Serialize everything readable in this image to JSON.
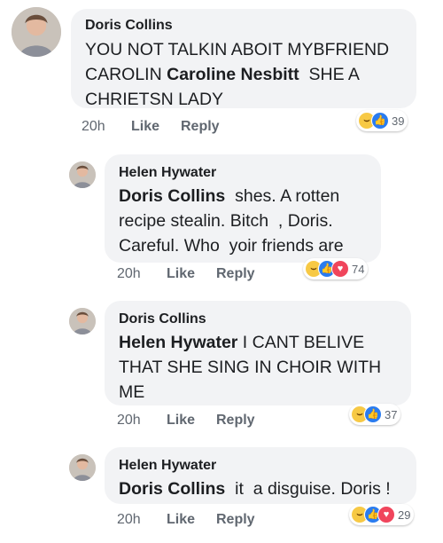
{
  "comments": [
    {
      "author": "Doris Collins",
      "lines": [
        [
          {
            "text": "YOU NOT TALKIN ABOIT MYBFRIEND"
          }
        ],
        [
          {
            "text": "CAROLIN "
          },
          {
            "text": "Caroline Nesbitt",
            "mention": true
          },
          {
            "text": "  SHE A"
          }
        ],
        [
          {
            "text": "CHRIETSN LADY"
          }
        ]
      ],
      "time": "20h",
      "like_label": "Like",
      "reply_label": "Reply",
      "reactions": [
        "haha",
        "like"
      ],
      "reaction_count": "39"
    },
    {
      "author": "Helen Hywater",
      "lines": [
        [
          {
            "text": "Doris Collins",
            "mention": true
          },
          {
            "text": "  shes. A rotten"
          }
        ],
        [
          {
            "text": "recipe stealin. Bitch  , Doris."
          }
        ],
        [
          {
            "text": "Careful. Who  yoir friends are"
          }
        ]
      ],
      "time": "20h",
      "like_label": "Like",
      "reply_label": "Reply",
      "reactions": [
        "haha",
        "like",
        "love"
      ],
      "reaction_count": "74"
    },
    {
      "author": "Doris Collins",
      "lines": [
        [
          {
            "text": "Helen Hywater",
            "mention": true
          },
          {
            "text": " I CANT BELIVE"
          }
        ],
        [
          {
            "text": "THAT SHE SING IN CHOIR WITH"
          }
        ],
        [
          {
            "text": "ME"
          }
        ]
      ],
      "time": "20h",
      "like_label": "Like",
      "reply_label": "Reply",
      "reactions": [
        "haha",
        "like"
      ],
      "reaction_count": "37"
    },
    {
      "author": "Helen Hywater",
      "lines": [
        [
          {
            "text": "Doris Collins",
            "mention": true
          },
          {
            "text": "  it  a disguise. Doris !"
          }
        ]
      ],
      "time": "20h",
      "like_label": "Like",
      "reply_label": "Reply",
      "reactions": [
        "haha",
        "like",
        "love"
      ],
      "reaction_count": "29"
    }
  ],
  "colors": {
    "bubble": "#f2f3f5",
    "text": "#1c1e21",
    "meta": "#606770",
    "like_blue": "#2a7cf0",
    "haha_yellow": "#f7c945",
    "love_red": "#f0455c"
  },
  "icons": {
    "haha": "haha-reaction-icon",
    "like": "like-reaction-icon",
    "love": "love-reaction-icon"
  }
}
